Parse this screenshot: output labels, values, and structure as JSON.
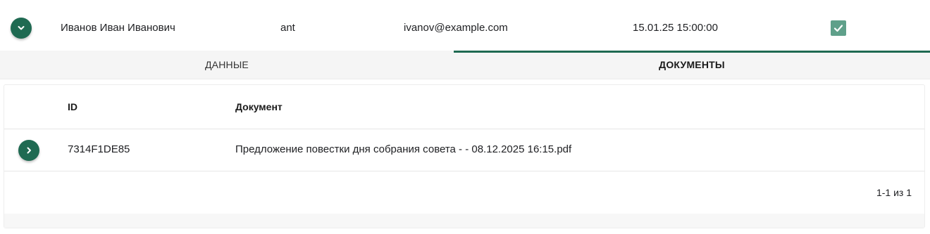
{
  "user_row": {
    "name": "Иванов Иван Иванович",
    "login": "ant",
    "email": "ivanov@example.com",
    "datetime": "15.01.25 15:00:00",
    "expand_icon": "chevron-down-icon",
    "checkbox_checked": true
  },
  "tabs": [
    {
      "label": "ДАННЫЕ",
      "active": false
    },
    {
      "label": "ДОКУМЕНТЫ",
      "active": true
    }
  ],
  "documents_table": {
    "columns": [
      "ID",
      "Документ"
    ],
    "rows": [
      {
        "id": "7314F1DE85",
        "document": "Предложение повестки дня собрания совета - - 08.12.2025 16:15.pdf"
      }
    ],
    "pagination": "1-1 из 1"
  },
  "colors": {
    "accent": "#1f6a52",
    "checkbox": "#5fa08a"
  }
}
